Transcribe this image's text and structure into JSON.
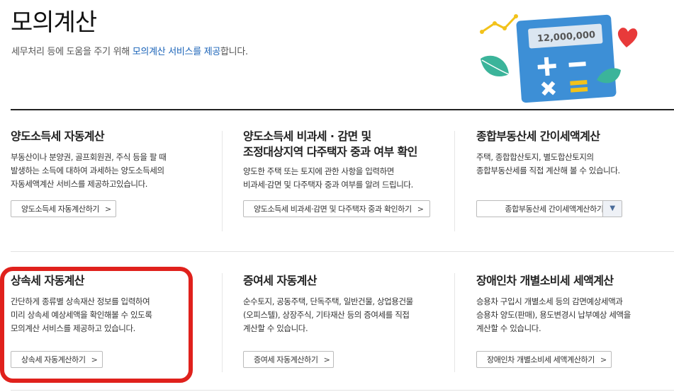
{
  "header": {
    "title": "모의계산",
    "subtitle_prefix": "세무처리 등에 도움을 주기 위해 ",
    "subtitle_link": "모의계산 서비스를 제공",
    "subtitle_suffix": "합니다.",
    "illustration_value": "12,000,000"
  },
  "cards": [
    {
      "title": "양도소득세 자동계산",
      "desc": "부동산이나 분양권, 골프회원권, 주식 등을 팔 때\n발생하는 소득에 대하여 과세하는 양도소득세의\n자동세액계산 서비스를 제공하고있습니다.",
      "button": "양도소득세 자동계산하기"
    },
    {
      "title": "양도소득세 비과세 · 감면 및\n조정대상지역 다주택자 중과 여부 확인",
      "desc": "양도한 주택 또는 토지에 관한 사항을 입력하면\n비과세·감면 및 다주택자 중과 여부를 알려 드립니다.",
      "button": "양도소득세 비과세·감면 및 다주택자 중과 확인하기"
    },
    {
      "title": "종합부동산세 간이세액계산",
      "desc": "주택, 종합합산토지, 별도합산토지의\n종합부동산세를 직접 계산해 볼 수 있습니다.",
      "button": "종합부동산세 간이세액계산하기"
    },
    {
      "title": "상속세 자동계산",
      "desc": "간단하게 종류별 상속재산 정보를 입력하여\n미리 상속세 예상세액을 확인해볼 수 있도록\n모의계산 서비스를 제공하고 있습니다.",
      "button": "상속세 자동계산하기"
    },
    {
      "title": "증여세 자동계산",
      "desc": "순수토지, 공동주택, 단독주택, 일반건물, 상업용건물\n(오피스텔), 상장주식, 기타재산 등의 증여세를 직접\n계산할 수 있습니다.",
      "button": "증여세 자동계산하기"
    },
    {
      "title": "장애인차 개별소비세 세액계산",
      "desc": "승용차 구입시 개별소세 등의 감면예상세액과\n승용차 양도(판매), 용도변경시 납부예상 세액을\n계산할 수 있습니다.",
      "button": "장애인차 개별소비세 세액계산하기"
    }
  ],
  "colors": {
    "link": "#1a63b8",
    "highlight": "#e0211c",
    "calculator": "#3d8fd6"
  }
}
